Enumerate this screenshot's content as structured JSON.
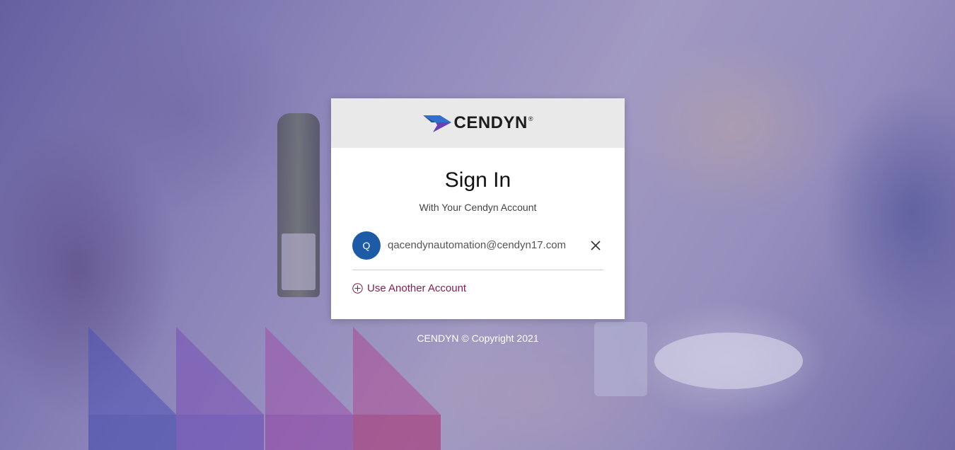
{
  "brand": {
    "name": "CENDYN",
    "registered_mark": "®",
    "colors": {
      "accent_blue": "#2f6fd0",
      "accent_purple": "#6a3fb5",
      "link": "#7d1f4f",
      "avatar_bg": "#1e5ba7"
    }
  },
  "signin": {
    "title": "Sign In",
    "subtitle": "With Your Cendyn Account"
  },
  "account": {
    "avatar_initial": "Q",
    "email": "qacendynautomation@cendyn17.com",
    "remove_icon": "close-icon"
  },
  "another_account": {
    "icon": "plus-circle-icon",
    "label": "Use Another Account"
  },
  "footer": {
    "text": "CENDYN © Copyright 2021"
  }
}
